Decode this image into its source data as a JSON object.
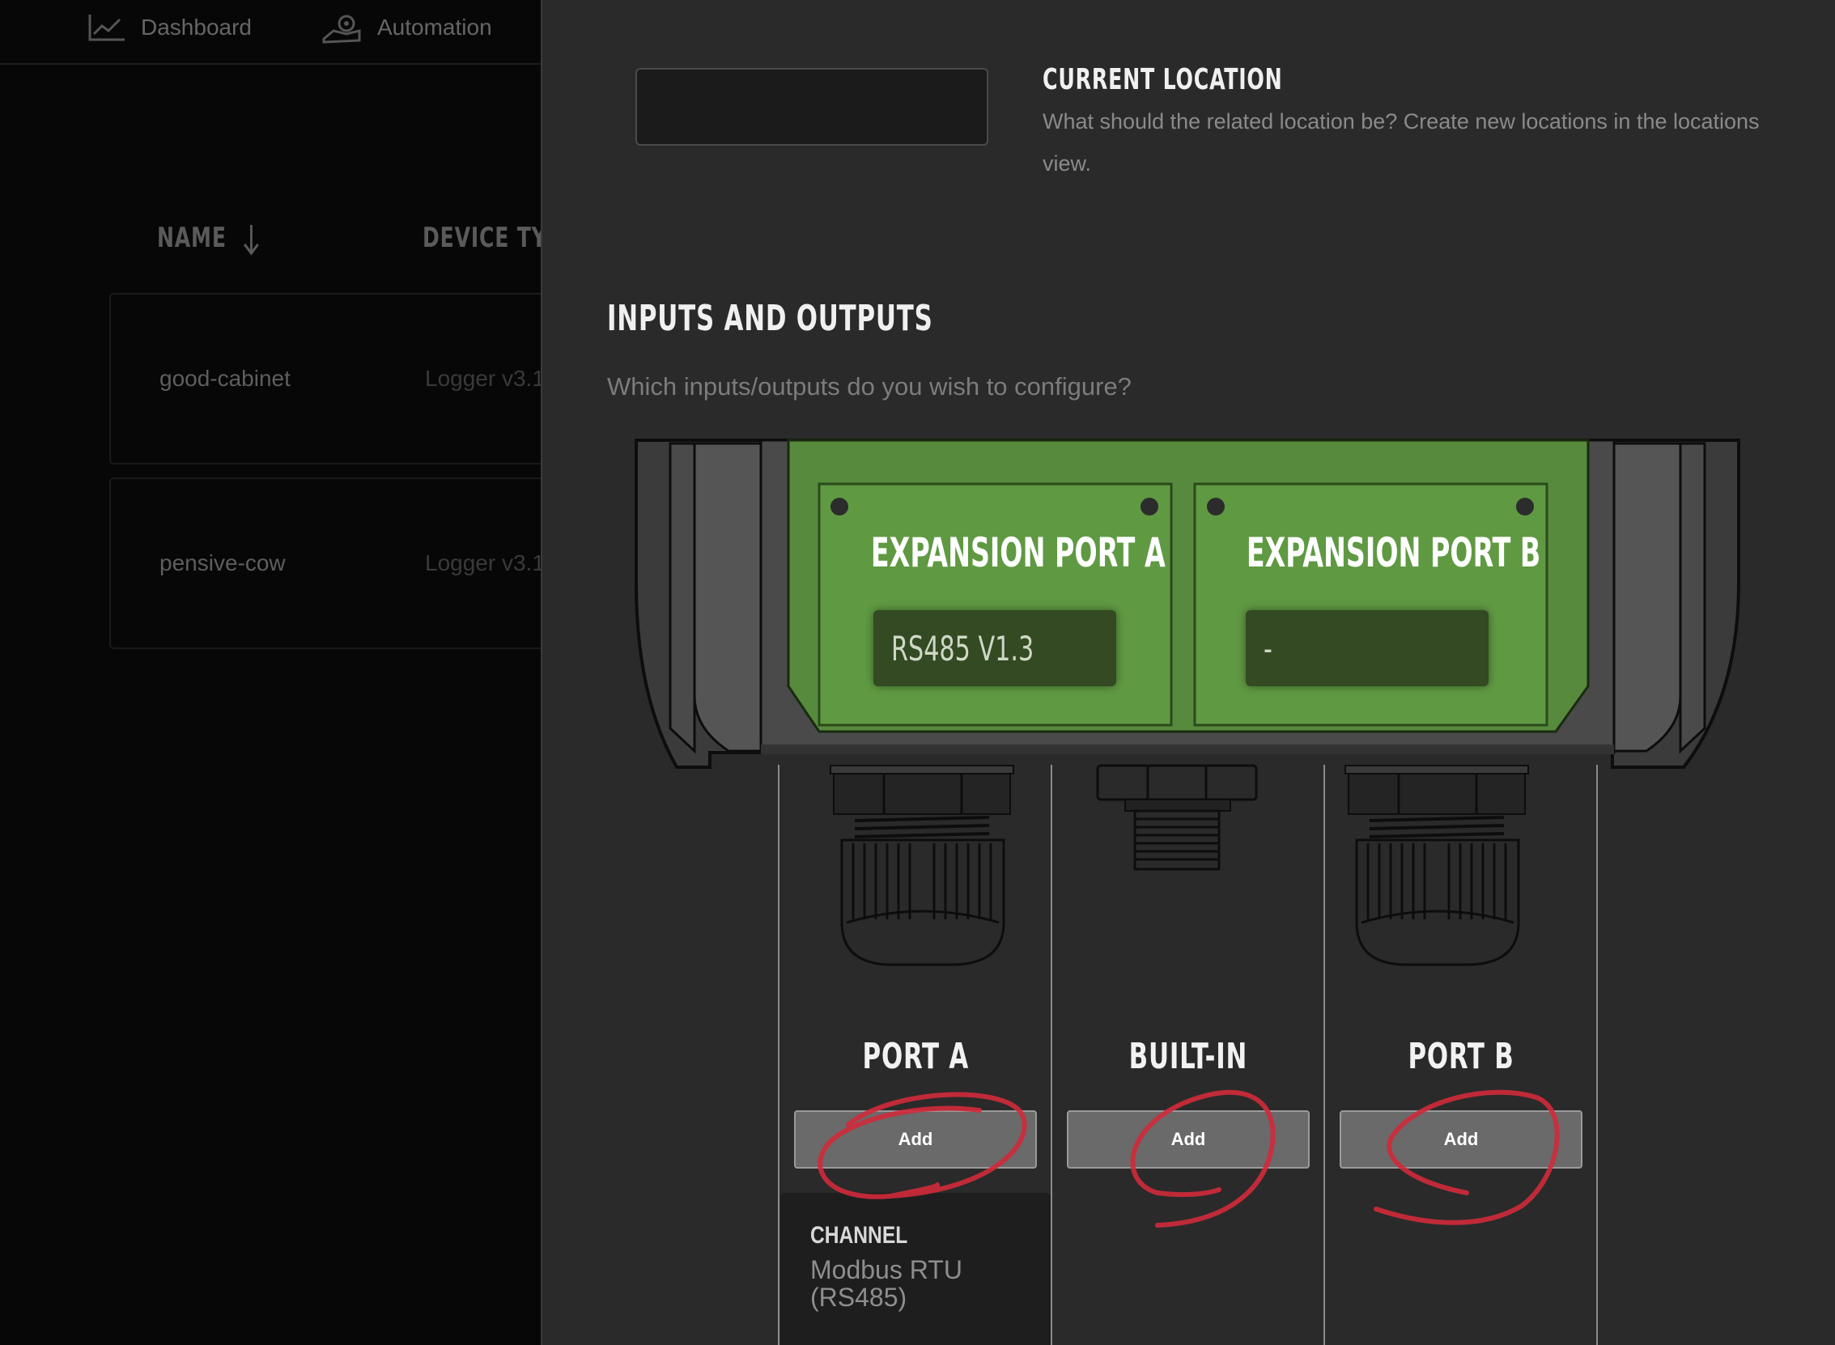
{
  "nav": {
    "items": [
      {
        "label": "Dashboard",
        "icon": "chart-line-icon"
      },
      {
        "label": "Automation",
        "icon": "hand-gear-icon"
      }
    ]
  },
  "table": {
    "headers": [
      "NAME",
      "DEVICE TYI"
    ],
    "sort_icon": "arrow-down-icon",
    "rows": [
      {
        "name": "good-cabinet",
        "type": "Logger v3.1"
      },
      {
        "name": "pensive-cow",
        "type": "Logger v3.1"
      }
    ]
  },
  "location": {
    "title": "CURRENT LOCATION",
    "description": "What should the related location be? Create new locations in the locations view.",
    "value": ""
  },
  "io": {
    "title": "INPUTS AND OUTPUTS",
    "description": "Which inputs/outputs do you wish to configure?"
  },
  "expansion": {
    "a": {
      "title": "EXPANSION PORT A",
      "value": "RS485 V1.3"
    },
    "b": {
      "title": "EXPANSION PORT B",
      "value": "-"
    }
  },
  "ports": [
    {
      "label": "PORT A",
      "button": "Add"
    },
    {
      "label": "BUILT-IN",
      "button": "Add"
    },
    {
      "label": "PORT B",
      "button": "Add"
    }
  ],
  "channel": {
    "label": "CHANNEL",
    "value": "Modbus RTU (RS485)"
  },
  "colors": {
    "panel_bg": "#2a2a2a",
    "board_green": "#5a9640",
    "annotation_red": "#d12a3a"
  }
}
